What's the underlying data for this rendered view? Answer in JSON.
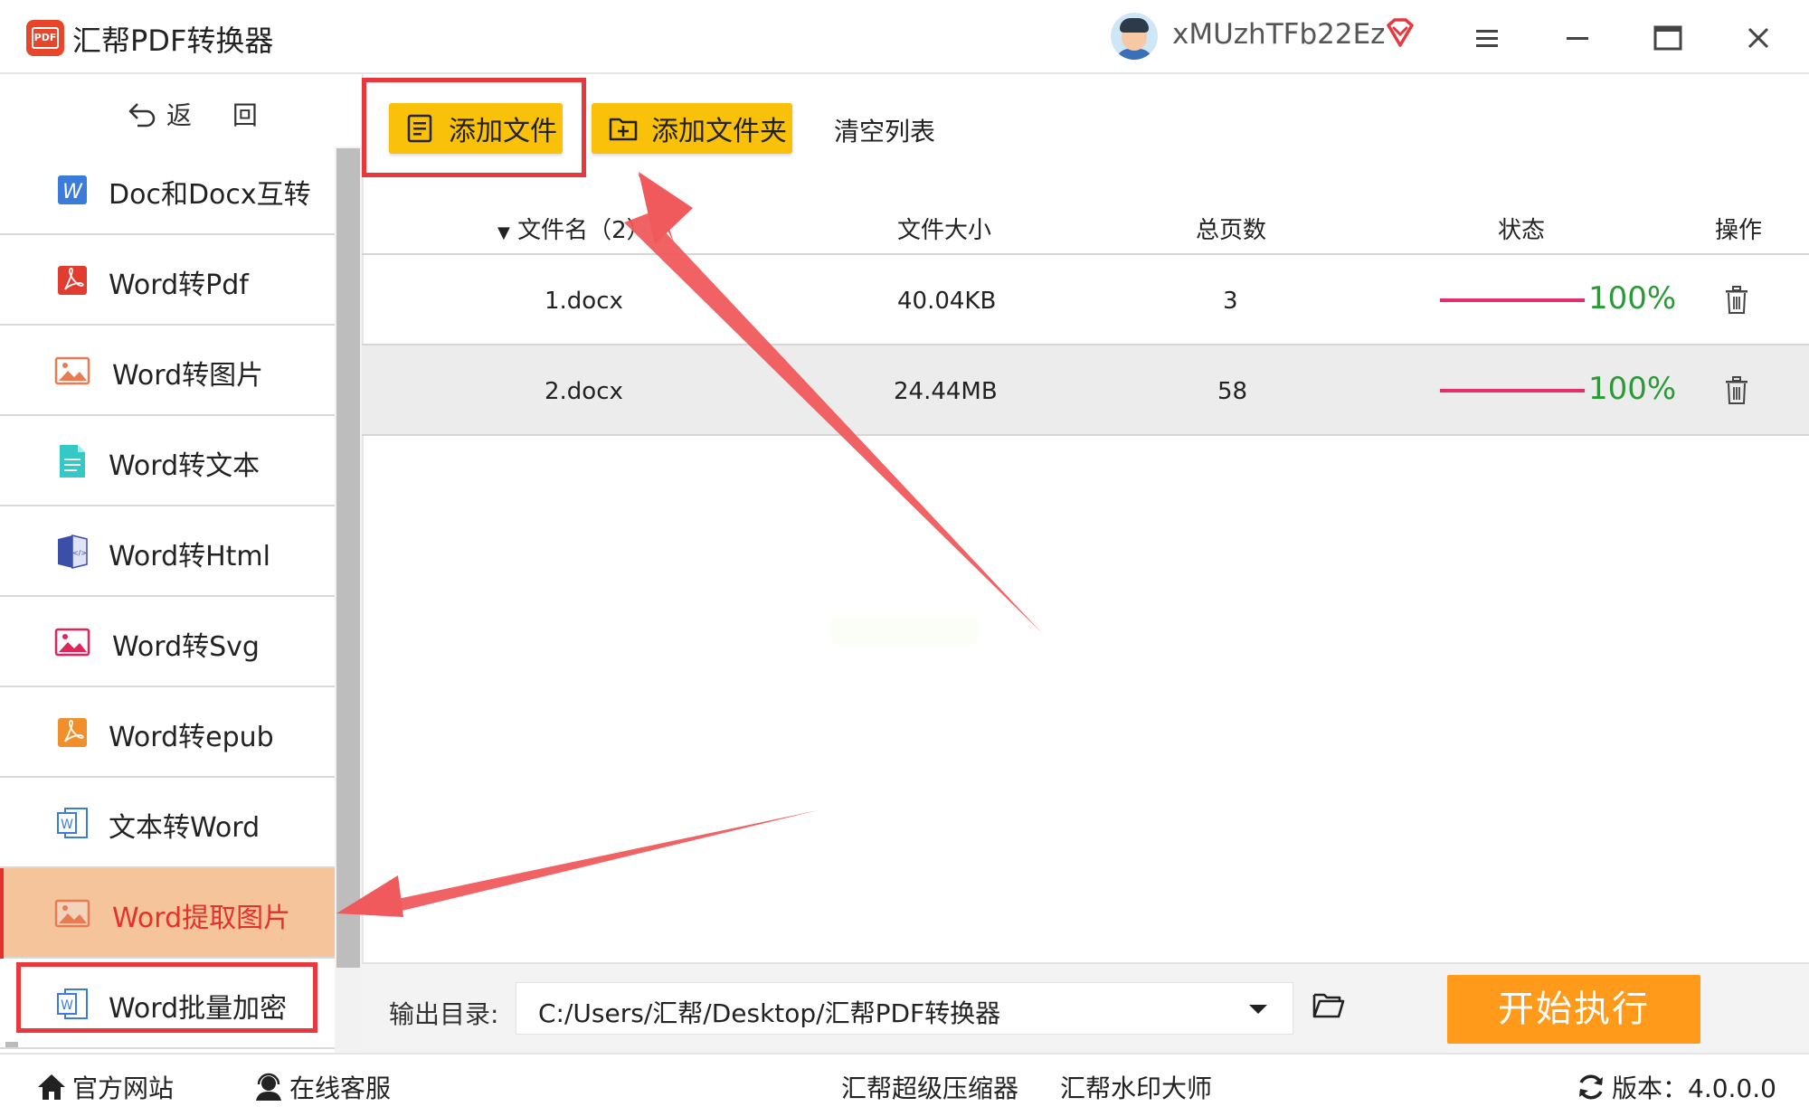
{
  "app": {
    "title": "汇帮PDF转换器",
    "logo_text": "PDF",
    "username": "xMUzhTFb22Ez"
  },
  "sidebar": {
    "back_label": "返 回",
    "items": [
      {
        "label": "Doc和Docx互转",
        "icon": "word-w-icon"
      },
      {
        "label": "Word转Pdf",
        "icon": "pdf-icon"
      },
      {
        "label": "Word转图片",
        "icon": "image-icon"
      },
      {
        "label": "Word转文本",
        "icon": "text-doc-icon"
      },
      {
        "label": "Word转Html",
        "icon": "html-book-icon"
      },
      {
        "label": "Word转Svg",
        "icon": "svg-image-icon"
      },
      {
        "label": "Word转epub",
        "icon": "epub-icon"
      },
      {
        "label": "文本转Word",
        "icon": "word-doc-icon"
      },
      {
        "label": "Word提取图片",
        "icon": "image-icon",
        "active": true
      },
      {
        "label": "Word批量加密",
        "icon": "word-doc-icon"
      }
    ]
  },
  "toolbar": {
    "add_file": "添加文件",
    "add_folder": "添加文件夹",
    "clear_list": "清空列表"
  },
  "table": {
    "headers": {
      "filename": "文件名（2）",
      "size": "文件大小",
      "pages": "总页数",
      "status": "状态",
      "action": "操作"
    },
    "rows": [
      {
        "name": "1.docx",
        "size": "40.04KB",
        "pages": "3",
        "status": "100%",
        "progress": 1.0
      },
      {
        "name": "2.docx",
        "size": "24.44MB",
        "pages": "58",
        "status": "100%",
        "progress": 1.0
      }
    ]
  },
  "output": {
    "label": "输出目录:",
    "path": "C:/Users/汇帮/Desktop/汇帮PDF转换器",
    "start_label": "开始执行"
  },
  "footer": {
    "website": "官方网站",
    "support": "在线客服",
    "compressor": "汇帮超级压缩器",
    "watermark": "汇帮水印大师",
    "version": "版本：4.0.0.0"
  },
  "colors": {
    "accent_yellow": "#f9c10a",
    "start_orange": "#ff9a1a",
    "active_item_bg": "#f6c49a",
    "active_text": "#e3312d",
    "progress_bar": "#e52f6a",
    "percent_green": "#2a9a36",
    "annotation_red": "#e8383d"
  }
}
